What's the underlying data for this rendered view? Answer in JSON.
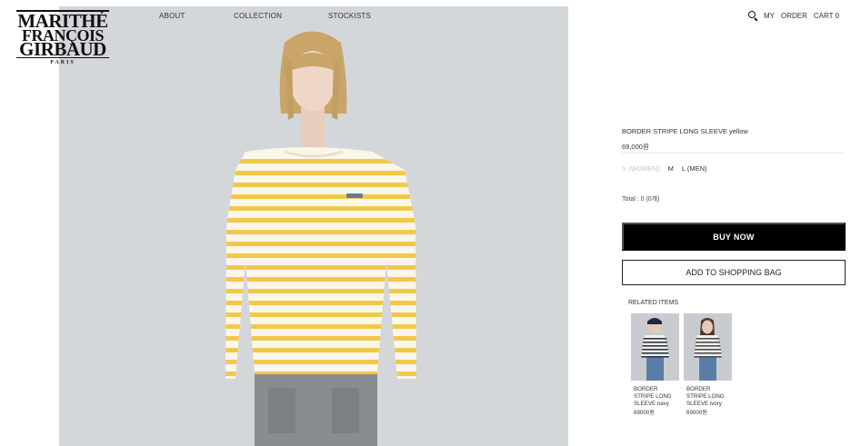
{
  "brand": {
    "line1": "MARITHÉ",
    "line2": "FRANÇOIS",
    "line3": "GIRBAUD",
    "city": "PARIS"
  },
  "nav": {
    "about": "ABOUT",
    "collection": "COLLECTION",
    "stockists": "STOCKISTS"
  },
  "utility": {
    "search_icon": "search-icon",
    "my": "MY",
    "order": "ORDER",
    "cart": "CART 0"
  },
  "product": {
    "name": "BORDER STRIPE LONG SLEEVE yellow",
    "price": "69,000원",
    "sizes": [
      {
        "label": "S (WOMEN)",
        "available": false
      },
      {
        "label": "M",
        "available": true
      },
      {
        "label": "L (MEN)",
        "available": true
      }
    ],
    "total": "Total : 0 (0개)",
    "buy_now": "BUY NOW",
    "add_to_bag": "ADD TO SHOPPING BAG",
    "stripe_color": "#f2c84b"
  },
  "related": {
    "title": "RELATED ITEMS",
    "items": [
      {
        "name": "BORDER STRIPE LONG SLEEVE navy",
        "price": "69000원",
        "stripe_color": "#2b3350"
      },
      {
        "name": "BORDER STRIPE LONG SLEEVE ivory",
        "price": "69000원",
        "stripe_color": "#4a4d5a"
      }
    ]
  }
}
